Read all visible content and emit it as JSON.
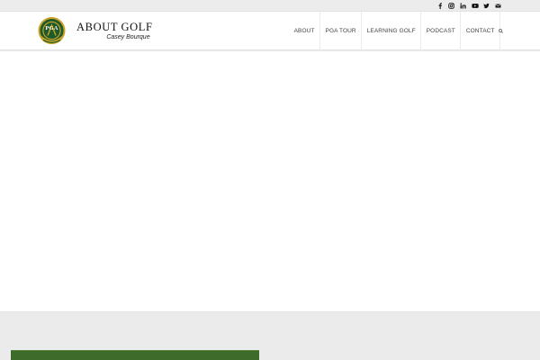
{
  "social": {
    "icons": [
      "facebook-icon",
      "instagram-icon",
      "linkedin-icon",
      "youtube-icon",
      "twitter-icon",
      "mail-icon"
    ]
  },
  "logo": {
    "badge_text": "PGA",
    "title": "ABOUT GOLF",
    "subtitle": "Casey Bourque"
  },
  "nav": {
    "items": [
      {
        "label": "ABOUT"
      },
      {
        "label": "PGA TOUR"
      },
      {
        "label": "LEARNING GOLF"
      },
      {
        "label": "PODCAST"
      },
      {
        "label": "CONTACT"
      }
    ],
    "search_icon": "search-icon"
  },
  "colors": {
    "topbar": "#ececec",
    "header": "#ffffff",
    "nav_text": "#444444",
    "badge_green": "#1f5a2c",
    "badge_gold": "#c9a227",
    "grass": "#3f6b2a"
  }
}
